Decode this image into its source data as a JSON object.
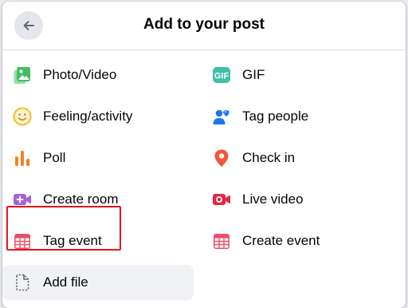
{
  "dialog": {
    "title": "Add to your post"
  },
  "options": {
    "photo_video": {
      "label": "Photo/Video",
      "icon": "photo-video-icon",
      "color": "#45bd62"
    },
    "gif": {
      "label": "GIF",
      "icon": "gif-icon",
      "color": "#3ebfa8"
    },
    "feeling_activity": {
      "label": "Feeling/activity",
      "icon": "smiley-icon",
      "color": "#f7b928"
    },
    "tag_people": {
      "label": "Tag people",
      "icon": "tag-people-icon",
      "color": "#1877f2"
    },
    "poll": {
      "label": "Poll",
      "icon": "poll-icon",
      "color": "#f5821f"
    },
    "check_in": {
      "label": "Check in",
      "icon": "location-pin-icon",
      "color": "#f5533d"
    },
    "create_room": {
      "label": "Create room",
      "icon": "video-room-icon",
      "color": "#a461d8"
    },
    "live_video": {
      "label": "Live video",
      "icon": "live-video-icon",
      "color": "#e42645"
    },
    "tag_event": {
      "label": "Tag event",
      "icon": "calendar-icon",
      "color": "#e9506a"
    },
    "create_event": {
      "label": "Create event",
      "icon": "calendar-icon",
      "color": "#e9506a"
    },
    "add_file": {
      "label": "Add file",
      "icon": "file-icon",
      "color": "#65676b"
    }
  },
  "highlight_color": "#e8141b"
}
